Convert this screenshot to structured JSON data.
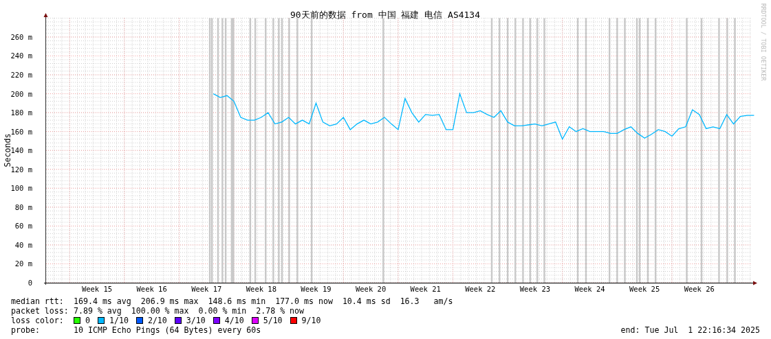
{
  "credit": "RRDTOOL / TOBI OETIKER",
  "chart_data": {
    "type": "line",
    "title": "90天前的数据 from 中国 福建 电信 AS4134",
    "ylabel": "Seconds",
    "ylim": [
      0,
      280
    ],
    "categories": [
      null,
      null,
      null,
      null,
      null,
      null,
      null,
      "Week 15",
      null,
      null,
      null,
      null,
      null,
      null,
      null,
      "Week 16",
      null,
      null,
      null,
      null,
      null,
      null,
      null,
      "Week 17",
      null,
      null,
      null,
      null,
      null,
      null,
      null,
      "Week 18",
      null,
      null,
      null,
      null,
      null,
      null,
      null,
      "Week 19",
      null,
      null,
      null,
      null,
      null,
      null,
      null,
      "Week 20",
      null,
      null,
      null,
      null,
      null,
      null,
      null,
      "Week 21",
      null,
      null,
      null,
      null,
      null,
      null,
      null,
      "Week 22",
      null,
      null,
      null,
      null,
      null,
      null,
      null,
      "Week 23",
      null,
      null,
      null,
      null,
      null,
      null,
      null,
      "Week 24",
      null,
      null,
      null,
      null,
      null,
      null,
      null,
      "Week 25",
      null,
      null,
      null,
      null,
      null,
      null,
      null,
      "Week 26",
      null,
      null,
      null,
      null,
      null,
      null,
      null,
      null
    ],
    "yticks": [
      {
        "value": 0,
        "label": "0"
      },
      {
        "value": 20,
        "label": "20 m"
      },
      {
        "value": 40,
        "label": "40 m"
      },
      {
        "value": 60,
        "label": "60 m"
      },
      {
        "value": 80,
        "label": "80 m"
      },
      {
        "value": 100,
        "label": "100 m"
      },
      {
        "value": 120,
        "label": "120 m"
      },
      {
        "value": 140,
        "label": "140 m"
      },
      {
        "value": 160,
        "label": "160 m"
      },
      {
        "value": 180,
        "label": "180 m"
      },
      {
        "value": 200,
        "label": "200 m"
      },
      {
        "value": 220,
        "label": "220 m"
      },
      {
        "value": 240,
        "label": "240 m"
      },
      {
        "value": 260,
        "label": "260 m"
      }
    ],
    "grid": true,
    "series": [
      {
        "name": "median rtt:",
        "color": "#00b8ff",
        "values": [
          null,
          null,
          null,
          null,
          null,
          null,
          null,
          null,
          null,
          null,
          null,
          null,
          null,
          null,
          null,
          null,
          null,
          null,
          null,
          null,
          null,
          null,
          null,
          null,
          200,
          196,
          198,
          192,
          175,
          172,
          172,
          175,
          180,
          168,
          170,
          175,
          168,
          172,
          168,
          190,
          170,
          166,
          168,
          175,
          162,
          168,
          172,
          168,
          170,
          175,
          168,
          162,
          195,
          180,
          170,
          178,
          177,
          178,
          162,
          162,
          200,
          180,
          180,
          182,
          178,
          175,
          182,
          170,
          166,
          166,
          167,
          168,
          166,
          168,
          170,
          152,
          165,
          160,
          163,
          160,
          160,
          160,
          158,
          158,
          162,
          165,
          158,
          153,
          157,
          162,
          160,
          155,
          163,
          165,
          183,
          178,
          163,
          165,
          163,
          178,
          168,
          176,
          177,
          177
        ]
      }
    ]
  },
  "legend": [
    {
      "kind": "series",
      "value": "169.4 ms avg  206.9 ms max  148.6 ms min  177.0 ms now  10.4 ms sd  16.3   am/s"
    },
    {
      "kind": "text",
      "label": "packet loss:",
      "value": "7.89 % avg  100.00 % max  0.00 % min  2.78 % now"
    },
    {
      "kind": "colors",
      "label": "loss color:",
      "items": [
        {
          "label": "0",
          "color": "#26ff00"
        },
        {
          "label": "1/10",
          "color": "#00b8ff"
        },
        {
          "label": "2/10",
          "color": "#0059ff"
        },
        {
          "label": "3/10",
          "color": "#5e00ff"
        },
        {
          "label": "4/10",
          "color": "#7e00ff"
        },
        {
          "label": "5/10",
          "color": "#dd00ff"
        },
        {
          "label": "9/10",
          "color": "#ff0000"
        }
      ]
    },
    {
      "kind": "text",
      "label": "probe:",
      "value": "10 ICMP Echo Pings (64 Bytes) every 60s",
      "end": "end: Tue Jul  1 22:16:34 2025"
    }
  ]
}
